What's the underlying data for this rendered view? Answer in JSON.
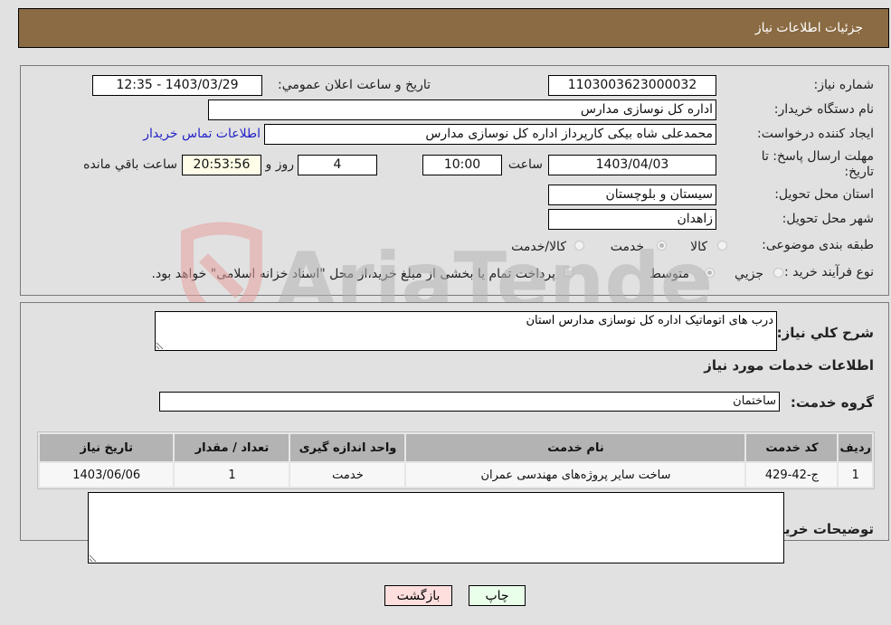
{
  "header": {
    "title": "جزئیات اطلاعات نیاز"
  },
  "details": {
    "need_number_label": "شماره نیاز:",
    "need_number": "1103003623000032",
    "announce_label": "تاریخ و ساعت اعلان عمومي:",
    "announce_value": "1403/03/29 - 12:35",
    "buyer_org_label": "نام دستگاه خریدار:",
    "buyer_org": "اداره کل نوسازی مدارس",
    "creator_label": "ایجاد کننده درخواست:",
    "creator": "محمدعلی شاه بیکی کارپرداز اداره کل نوسازی مدارس",
    "contact_link": "اطلاعات تماس خریدار",
    "deadline_label": "مهلت ارسال پاسخ: تا تاریخ:",
    "deadline_date": "1403/04/03",
    "time_label": "ساعت",
    "deadline_time": "10:00",
    "days": "4",
    "days_label": "روز و",
    "remaining": "20:53:56",
    "remaining_label": "ساعت باقي مانده",
    "province_label": "استان محل تحویل:",
    "province": "سیستان و بلوچستان",
    "city_label": "شهر محل تحویل:",
    "city": "زاهدان",
    "category_label": "طبقه بندی موضوعی:",
    "category_options": [
      {
        "label": "کالا",
        "selected": false
      },
      {
        "label": "خدمت",
        "selected": true
      },
      {
        "label": "کالا/خدمت",
        "selected": false
      }
    ],
    "process_label": "نوع فرآیند خرید :",
    "process_options": [
      {
        "label": "جزيي",
        "selected": false
      },
      {
        "label": "متوسط",
        "selected": true
      }
    ],
    "treasury_note": "پرداخت تمام یا بخشی از مبلغ خرید،از محل \"اسناد خزانه اسلامی\" خواهد بود."
  },
  "services": {
    "description_label": "شرح کلي نیاز:",
    "description": "درب های اتوماتیک اداره کل نوسازی مدارس استان",
    "section_title": "اطلاعات خدمات مورد نیاز",
    "group_label": "گروه خدمت:",
    "group": "ساختمان",
    "table": {
      "headers": [
        "ردیف",
        "کد خدمت",
        "نام خدمت",
        "واحد اندازه گیری",
        "تعداد / مقدار",
        "تاریخ نیاز"
      ],
      "rows": [
        [
          "1",
          "ج-42-429",
          "ساخت سایر پروژه‌های مهندسی عمران",
          "خدمت",
          "1",
          "1403/06/06"
        ]
      ]
    },
    "buyer_notes_label": "توضیحات خریدار:",
    "buyer_notes": ""
  },
  "buttons": {
    "print": "چاپ",
    "back": "بازگشت"
  },
  "watermark": {
    "text": "AriaTender.neT"
  },
  "colors": {
    "header_bg": "#8b6b43",
    "print_bg": "#eaffea",
    "back_bg": "#ffdede",
    "link": "#2323c8"
  }
}
